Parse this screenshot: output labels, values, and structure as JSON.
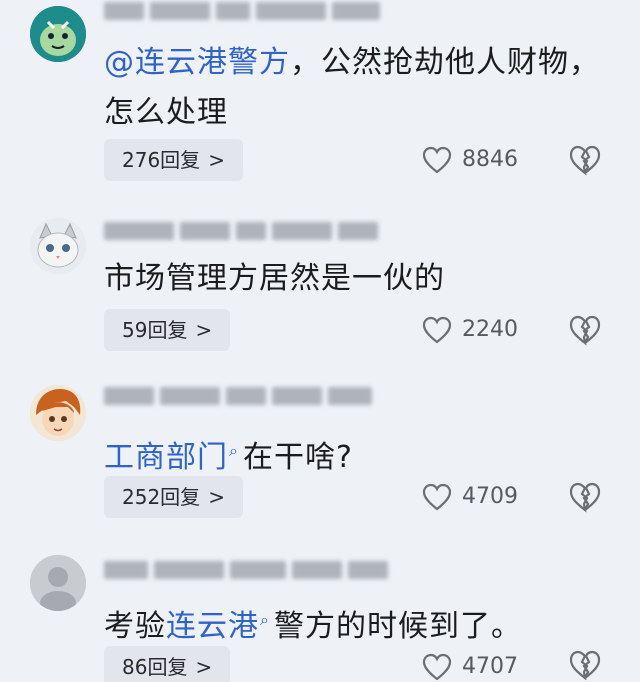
{
  "comments": [
    {
      "id": 1,
      "mention": "@连云港警方",
      "text": "，公然抢劫他人财物，怎么处理",
      "reply_label": "276回复",
      "likes": "8846"
    },
    {
      "id": 2,
      "text": "市场管理方居然是一伙的",
      "reply_label": "59回复",
      "likes": "2240"
    },
    {
      "id": 3,
      "mention": "工商部门",
      "text": "在干啥?",
      "reply_label": "252回复",
      "likes": "4709"
    },
    {
      "id": 4,
      "prefix": "考验",
      "mention": "连云港",
      "text": "警方的时候到了。",
      "reply_label": "86回复",
      "likes": "4707"
    }
  ],
  "icons": {
    "like": "heart-outline-icon",
    "dislike": "broken-heart-icon",
    "chevron": "chevron-right-icon",
    "search": "search-icon"
  },
  "colors": {
    "background": "#eef1f5",
    "link": "#2f63c8",
    "chip": "#e2e6ec"
  }
}
